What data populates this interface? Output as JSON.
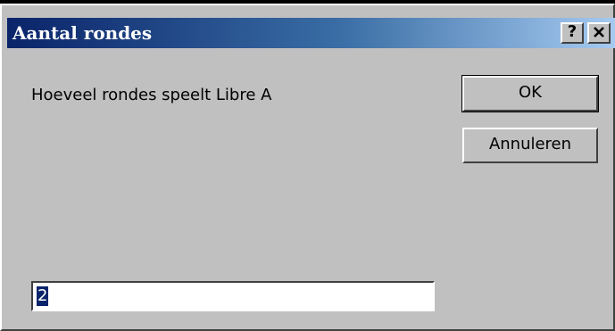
{
  "window": {
    "title": "Aantal rondes",
    "help_label": "?",
    "close_icon": "close-icon"
  },
  "dialog": {
    "prompt": "Hoeveel rondes speelt Libre A",
    "ok_label": "OK",
    "cancel_label": "Annuleren",
    "input_value": "2"
  },
  "colors": {
    "titlebar_start": "#0a246a",
    "titlebar_end": "#a6caf0",
    "face": "#c0c0c0",
    "selection": "#0a246a"
  }
}
